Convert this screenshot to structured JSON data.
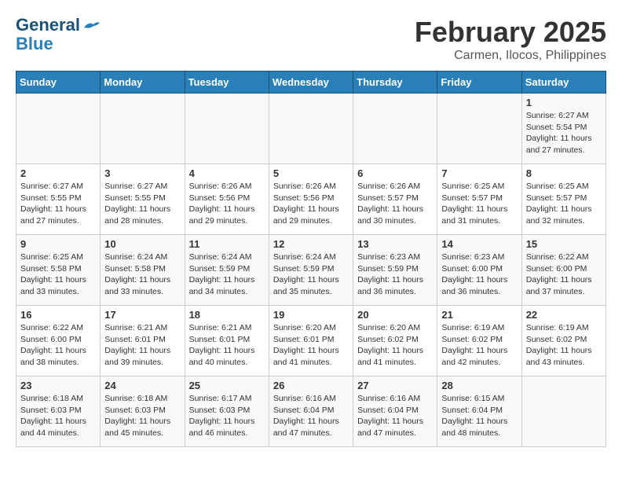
{
  "logo": {
    "text_general": "General",
    "text_blue": "Blue"
  },
  "title": {
    "month_year": "February 2025",
    "location": "Carmen, Ilocos, Philippines"
  },
  "headers": [
    "Sunday",
    "Monday",
    "Tuesday",
    "Wednesday",
    "Thursday",
    "Friday",
    "Saturday"
  ],
  "weeks": [
    [
      {
        "day": "",
        "info": ""
      },
      {
        "day": "",
        "info": ""
      },
      {
        "day": "",
        "info": ""
      },
      {
        "day": "",
        "info": ""
      },
      {
        "day": "",
        "info": ""
      },
      {
        "day": "",
        "info": ""
      },
      {
        "day": "1",
        "info": "Sunrise: 6:27 AM\nSunset: 5:54 PM\nDaylight: 11 hours\nand 27 minutes."
      }
    ],
    [
      {
        "day": "2",
        "info": "Sunrise: 6:27 AM\nSunset: 5:55 PM\nDaylight: 11 hours\nand 27 minutes."
      },
      {
        "day": "3",
        "info": "Sunrise: 6:27 AM\nSunset: 5:55 PM\nDaylight: 11 hours\nand 28 minutes."
      },
      {
        "day": "4",
        "info": "Sunrise: 6:26 AM\nSunset: 5:56 PM\nDaylight: 11 hours\nand 29 minutes."
      },
      {
        "day": "5",
        "info": "Sunrise: 6:26 AM\nSunset: 5:56 PM\nDaylight: 11 hours\nand 29 minutes."
      },
      {
        "day": "6",
        "info": "Sunrise: 6:26 AM\nSunset: 5:57 PM\nDaylight: 11 hours\nand 30 minutes."
      },
      {
        "day": "7",
        "info": "Sunrise: 6:25 AM\nSunset: 5:57 PM\nDaylight: 11 hours\nand 31 minutes."
      },
      {
        "day": "8",
        "info": "Sunrise: 6:25 AM\nSunset: 5:57 PM\nDaylight: 11 hours\nand 32 minutes."
      }
    ],
    [
      {
        "day": "9",
        "info": "Sunrise: 6:25 AM\nSunset: 5:58 PM\nDaylight: 11 hours\nand 33 minutes."
      },
      {
        "day": "10",
        "info": "Sunrise: 6:24 AM\nSunset: 5:58 PM\nDaylight: 11 hours\nand 33 minutes."
      },
      {
        "day": "11",
        "info": "Sunrise: 6:24 AM\nSunset: 5:59 PM\nDaylight: 11 hours\nand 34 minutes."
      },
      {
        "day": "12",
        "info": "Sunrise: 6:24 AM\nSunset: 5:59 PM\nDaylight: 11 hours\nand 35 minutes."
      },
      {
        "day": "13",
        "info": "Sunrise: 6:23 AM\nSunset: 5:59 PM\nDaylight: 11 hours\nand 36 minutes."
      },
      {
        "day": "14",
        "info": "Sunrise: 6:23 AM\nSunset: 6:00 PM\nDaylight: 11 hours\nand 36 minutes."
      },
      {
        "day": "15",
        "info": "Sunrise: 6:22 AM\nSunset: 6:00 PM\nDaylight: 11 hours\nand 37 minutes."
      }
    ],
    [
      {
        "day": "16",
        "info": "Sunrise: 6:22 AM\nSunset: 6:00 PM\nDaylight: 11 hours\nand 38 minutes."
      },
      {
        "day": "17",
        "info": "Sunrise: 6:21 AM\nSunset: 6:01 PM\nDaylight: 11 hours\nand 39 minutes."
      },
      {
        "day": "18",
        "info": "Sunrise: 6:21 AM\nSunset: 6:01 PM\nDaylight: 11 hours\nand 40 minutes."
      },
      {
        "day": "19",
        "info": "Sunrise: 6:20 AM\nSunset: 6:01 PM\nDaylight: 11 hours\nand 41 minutes."
      },
      {
        "day": "20",
        "info": "Sunrise: 6:20 AM\nSunset: 6:02 PM\nDaylight: 11 hours\nand 41 minutes."
      },
      {
        "day": "21",
        "info": "Sunrise: 6:19 AM\nSunset: 6:02 PM\nDaylight: 11 hours\nand 42 minutes."
      },
      {
        "day": "22",
        "info": "Sunrise: 6:19 AM\nSunset: 6:02 PM\nDaylight: 11 hours\nand 43 minutes."
      }
    ],
    [
      {
        "day": "23",
        "info": "Sunrise: 6:18 AM\nSunset: 6:03 PM\nDaylight: 11 hours\nand 44 minutes."
      },
      {
        "day": "24",
        "info": "Sunrise: 6:18 AM\nSunset: 6:03 PM\nDaylight: 11 hours\nand 45 minutes."
      },
      {
        "day": "25",
        "info": "Sunrise: 6:17 AM\nSunset: 6:03 PM\nDaylight: 11 hours\nand 46 minutes."
      },
      {
        "day": "26",
        "info": "Sunrise: 6:16 AM\nSunset: 6:04 PM\nDaylight: 11 hours\nand 47 minutes."
      },
      {
        "day": "27",
        "info": "Sunrise: 6:16 AM\nSunset: 6:04 PM\nDaylight: 11 hours\nand 47 minutes."
      },
      {
        "day": "28",
        "info": "Sunrise: 6:15 AM\nSunset: 6:04 PM\nDaylight: 11 hours\nand 48 minutes."
      },
      {
        "day": "",
        "info": ""
      }
    ]
  ]
}
